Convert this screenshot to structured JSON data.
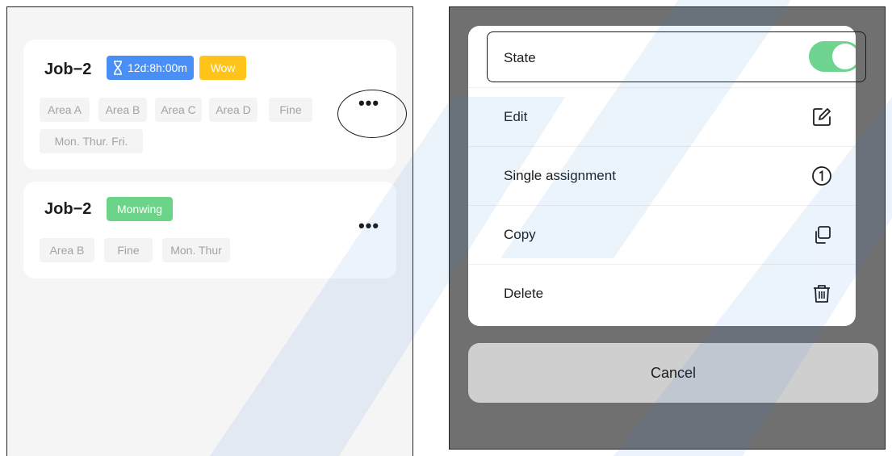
{
  "left": {
    "cards": [
      {
        "title": "Job−2",
        "timer_badge": "12d:8h:00m",
        "tag_badge": "Wow",
        "chips": [
          "Area A",
          "Area B",
          "Area C",
          "Area D",
          "Fine",
          "Mon. Thur. Fri."
        ],
        "more_label": "•••"
      },
      {
        "title": "Job−2",
        "tag_badge": "Monwing",
        "chips": [
          "Area B",
          "Fine",
          "Mon. Thur"
        ],
        "more_label": "•••"
      }
    ]
  },
  "right": {
    "menu": {
      "state_label": "State",
      "state_on": true,
      "edit_label": "Edit",
      "single_label": "Single assignment",
      "copy_label": "Copy",
      "delete_label": "Delete"
    },
    "cancel_label": "Cancel"
  },
  "colors": {
    "timer_badge": "#4a8ff5",
    "wow_badge": "#ffc31a",
    "monwing_badge": "#6bd489",
    "toggle_on": "#6ed48f",
    "overlay": "#707070"
  },
  "icons": {
    "timer": "hourglass-icon",
    "edit": "edit-icon",
    "single": "number-one-circle-icon",
    "copy": "copy-icon",
    "delete": "trash-icon"
  }
}
